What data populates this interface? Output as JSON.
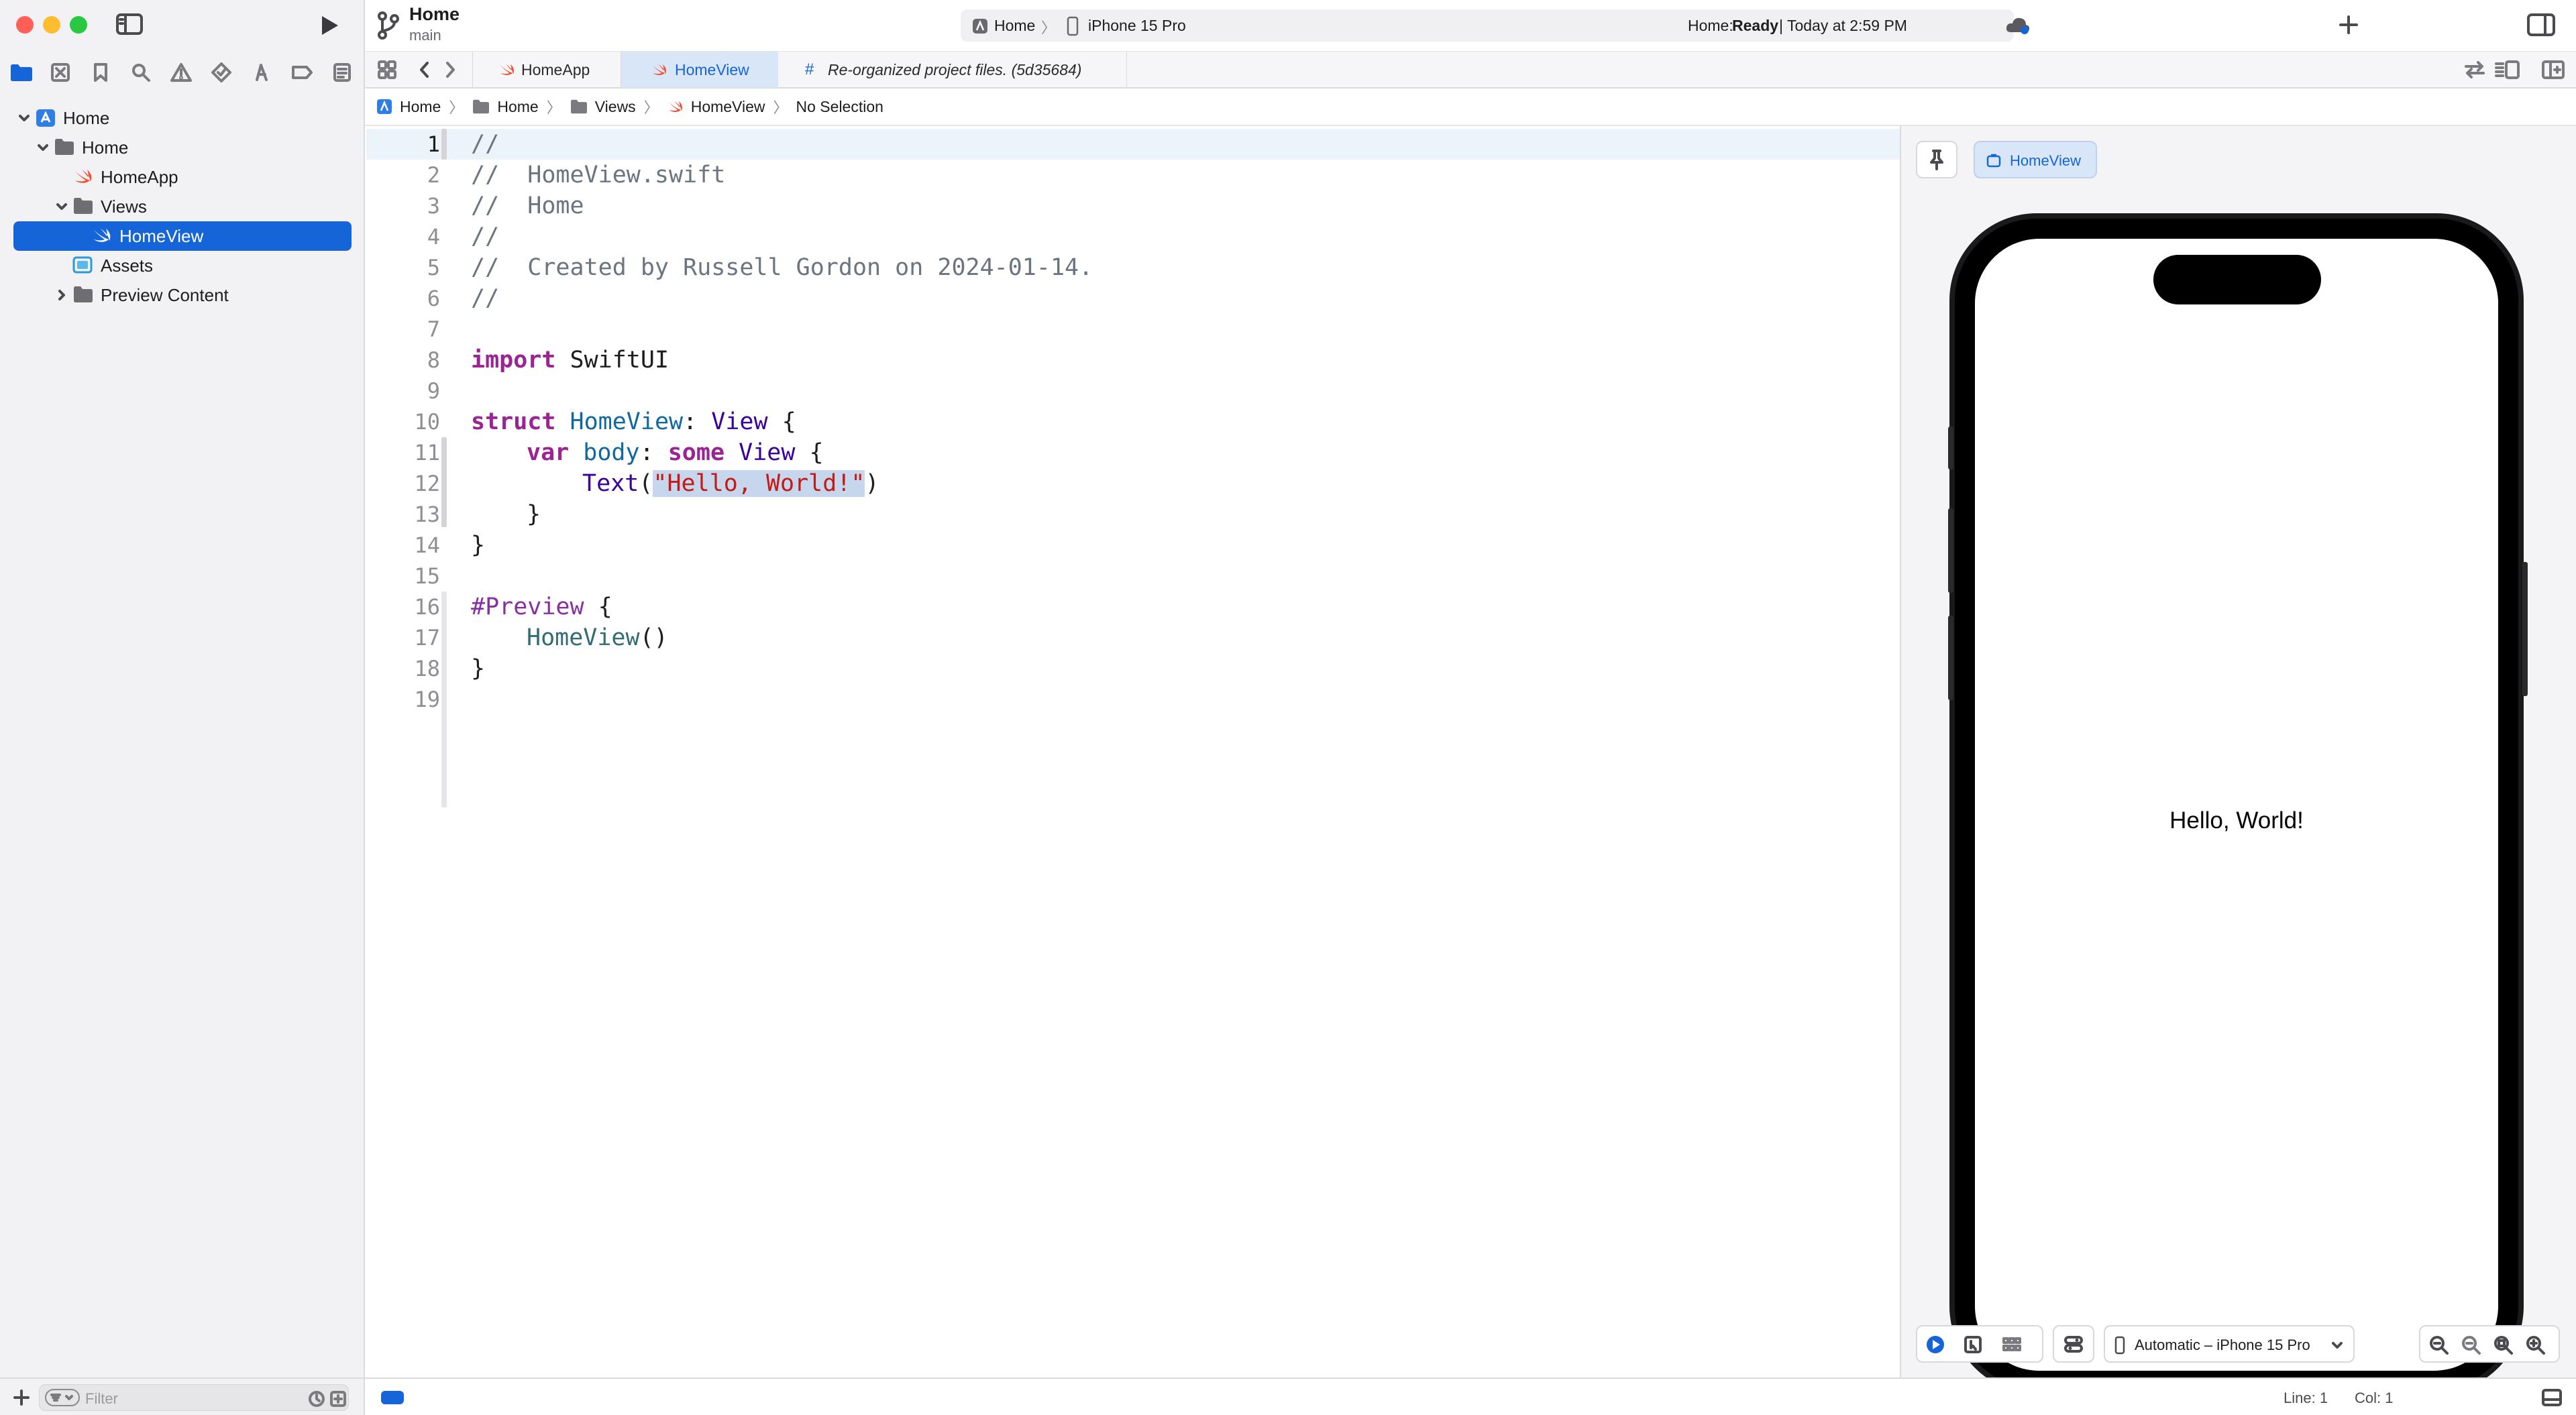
{
  "window": {
    "project_name": "Home",
    "branch": "main"
  },
  "activity": {
    "scheme": "Home",
    "destination": "iPhone 15 Pro",
    "status_prefix": "Home:",
    "status_state": "Ready",
    "status_time": "| Today at 2:59 PM"
  },
  "navigator": {
    "tree": [
      {
        "label": "Home",
        "type": "project"
      },
      {
        "label": "Home",
        "type": "folder"
      },
      {
        "label": "HomeApp",
        "type": "swift-file"
      },
      {
        "label": "Views",
        "type": "folder"
      },
      {
        "label": "HomeView",
        "type": "swift-file",
        "selected": true
      },
      {
        "label": "Assets",
        "type": "asset-catalog"
      },
      {
        "label": "Preview Content",
        "type": "folder"
      }
    ],
    "filter_placeholder": "Filter"
  },
  "tabs": [
    {
      "label": "HomeApp",
      "icon": "swift-icon"
    },
    {
      "label": "HomeView",
      "icon": "swift-icon",
      "active": true
    },
    {
      "label": "Re-organized project files. (5d35684)",
      "icon": "hash-icon"
    }
  ],
  "jumpbar": {
    "crumbs": [
      "Home",
      "Home",
      "Views",
      "HomeView",
      "No Selection"
    ]
  },
  "editor": {
    "line_numbers": [
      "1",
      "2",
      "3",
      "4",
      "5",
      "6",
      "7",
      "8",
      "9",
      "10",
      "11",
      "12",
      "13",
      "14",
      "15",
      "16",
      "17",
      "18",
      "19"
    ],
    "current_line": 1,
    "code": {
      "l1": "//",
      "l2": "//  HomeView.swift",
      "l3": "//  Home",
      "l4": "//",
      "l5": "//  Created by Russell Gordon on 2024-01-14.",
      "l6": "//",
      "kw_import": "import",
      "mod_swiftui": " SwiftUI",
      "kw_struct": "struct",
      "type_homeview": " HomeView",
      "colon_view": ": ",
      "type_view": "View",
      "brace_open": " {",
      "kw_var": "var",
      "prop_body": " body",
      "colon": ": ",
      "kw_some": "some",
      "type_view2": " View",
      "brace_open2": " {",
      "text_fn": "Text",
      "paren_open": "(",
      "string_hello": "\"Hello, World!\"",
      "paren_close": ")",
      "brace_close": "}",
      "macro_preview": "#Preview",
      "brace_open3": " {",
      "call_homeview": "HomeView",
      "call_parens": "()"
    }
  },
  "canvas": {
    "preview_tab": "HomeView",
    "preview_text": "Hello, World!",
    "device_menu": "Automatic – iPhone 15 Pro"
  },
  "statusbar": {
    "line": "Line: 1",
    "col": "Col: 1"
  },
  "colors": {
    "accent": "#1565d8",
    "keyword": "#9b2393",
    "string": "#c41a16",
    "comment": "#6b7580"
  }
}
